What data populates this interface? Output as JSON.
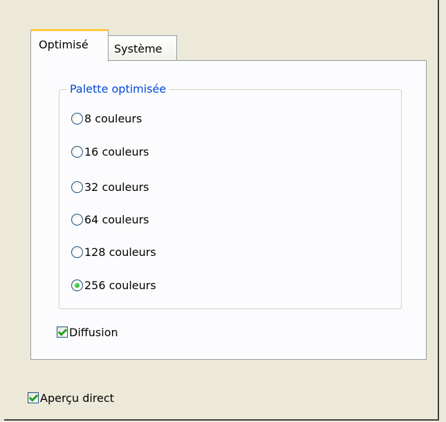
{
  "tabs": [
    {
      "label": "Optimisé",
      "active": true
    },
    {
      "label": "Système",
      "active": false
    }
  ],
  "palette_group": {
    "legend": "Palette optimisée",
    "options": [
      {
        "label": "8 couleurs",
        "selected": false
      },
      {
        "label": "16 couleurs",
        "selected": false
      },
      {
        "label": "32 couleurs",
        "selected": false
      },
      {
        "label": "64 couleurs",
        "selected": false
      },
      {
        "label": "128 couleurs",
        "selected": false
      },
      {
        "label": "256 couleurs",
        "selected": true
      }
    ]
  },
  "diffusion": {
    "label": "Diffusion",
    "checked": true
  },
  "live_preview": {
    "label": "Aperçu direct",
    "checked": true
  },
  "colors": {
    "legend_text": "#0046d5",
    "active_tab_accent": "#ffc83c",
    "check_mark": "#21a121"
  }
}
